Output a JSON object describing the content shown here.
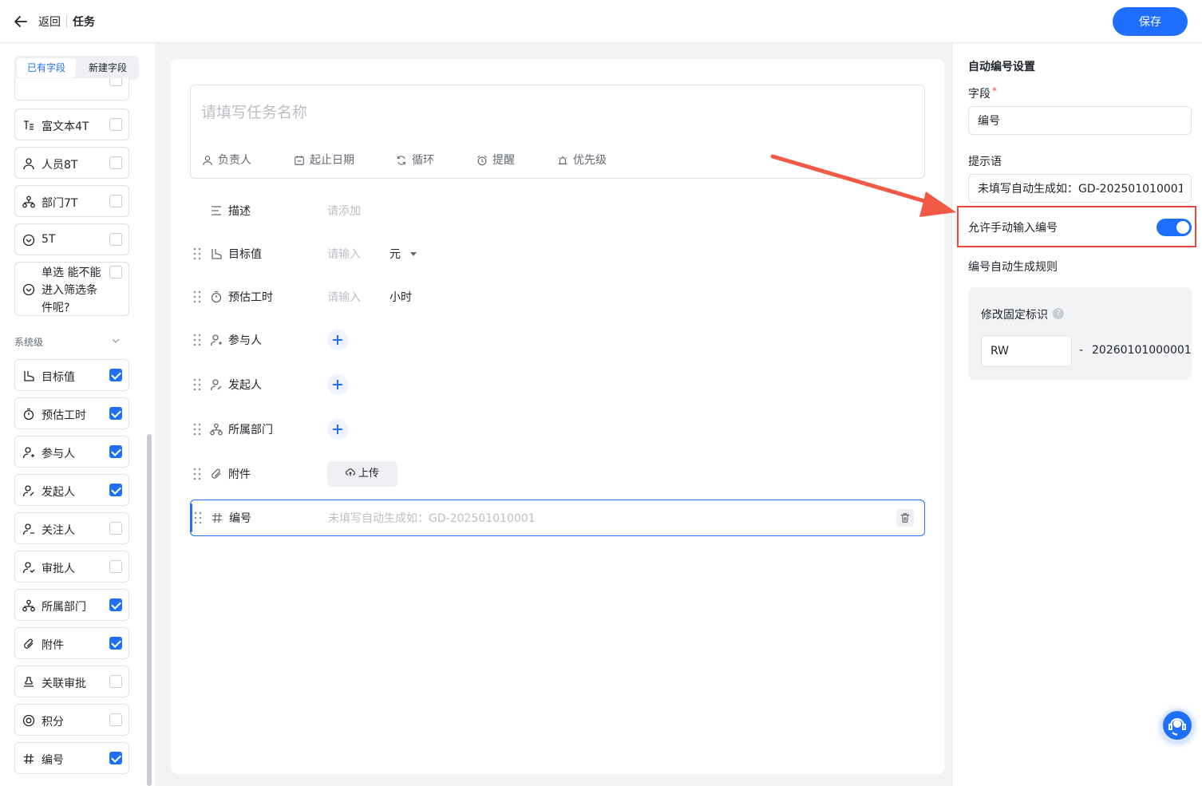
{
  "header": {
    "back_label": "返回",
    "title": "任务",
    "save_label": "保存"
  },
  "sidebar": {
    "tabs": {
      "existing": "已有字段",
      "new": "新建字段"
    },
    "custom_fields": [
      {
        "label": "富文本4T",
        "checked": false
      },
      {
        "label": "人员8T",
        "checked": false
      },
      {
        "label": "部门7T",
        "checked": false
      },
      {
        "label": "5T",
        "checked": false
      },
      {
        "label": "单选 能不能进入筛选条件呢?",
        "checked": false
      }
    ],
    "system_section_label": "系统级",
    "system_fields": [
      {
        "label": "目标值",
        "checked": true
      },
      {
        "label": "预估工时",
        "checked": true
      },
      {
        "label": "参与人",
        "checked": true
      },
      {
        "label": "发起人",
        "checked": true
      },
      {
        "label": "关注人",
        "checked": false
      },
      {
        "label": "审批人",
        "checked": false
      },
      {
        "label": "所属部门",
        "checked": true
      },
      {
        "label": "附件",
        "checked": true
      },
      {
        "label": "关联审批",
        "checked": false
      },
      {
        "label": "积分",
        "checked": false
      },
      {
        "label": "编号",
        "checked": true
      }
    ]
  },
  "form": {
    "title_placeholder": "请填写任务名称",
    "attributes": [
      "负责人",
      "起止日期",
      "循环",
      "提醒",
      "优先级"
    ],
    "rows": {
      "desc": {
        "label": "描述",
        "placeholder": "请添加"
      },
      "target": {
        "label": "目标值",
        "placeholder": "请输入",
        "unit": "元"
      },
      "hours": {
        "label": "预估工时",
        "placeholder": "请输入",
        "unit": "小时"
      },
      "participants": {
        "label": "参与人"
      },
      "initiator": {
        "label": "发起人"
      },
      "department": {
        "label": "所属部门"
      },
      "attachment": {
        "label": "附件",
        "upload": "上传"
      },
      "number": {
        "label": "编号",
        "placeholder": "未填写自动生成如：GD-202501010001"
      }
    }
  },
  "panel": {
    "title": "自动编号设置",
    "field_label": "字段",
    "field_value": "编号",
    "hint_label": "提示语",
    "hint_value": "未填写自动生成如：GD-202501010001",
    "toggle_label": "允许手动输入编号",
    "toggle_on": true,
    "rule_title": "编号自动生成规则",
    "fixed_label": "修改固定标识",
    "help_glyph": "?",
    "prefix_value": "RW",
    "dash": "-",
    "serial": "20260101000001"
  },
  "colors": {
    "accent": "#1e6fff",
    "highlight_border": "#e8473a"
  }
}
